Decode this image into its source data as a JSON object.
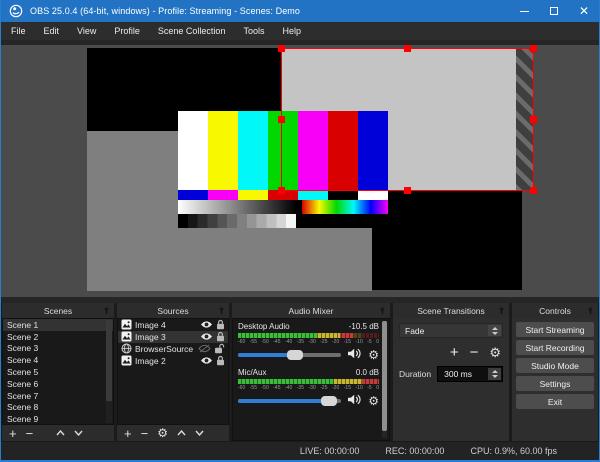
{
  "window": {
    "title": "OBS 25.0.4 (64-bit, windows) - Profile: Streaming - Scenes: Demo"
  },
  "menu": {
    "items": [
      "File",
      "Edit",
      "View",
      "Profile",
      "Scene Collection",
      "Tools",
      "Help"
    ]
  },
  "scenes": {
    "title": "Scenes",
    "items": [
      "Scene 1",
      "Scene 2",
      "Scene 3",
      "Scene 4",
      "Scene 5",
      "Scene 6",
      "Scene 7",
      "Scene 8",
      "Scene 9"
    ],
    "selected": "Scene 1"
  },
  "sources": {
    "title": "Sources",
    "items": [
      {
        "name": "Image 4",
        "type": "image",
        "visible": true,
        "locked": true
      },
      {
        "name": "Image 3",
        "type": "image",
        "visible": true,
        "locked": true,
        "selected": true
      },
      {
        "name": "BrowserSource",
        "type": "browser",
        "visible": false,
        "locked": false
      },
      {
        "name": "Image 2",
        "type": "image",
        "visible": true,
        "locked": true
      }
    ]
  },
  "mixer": {
    "title": "Audio Mixer",
    "ticks": [
      "-60",
      "-55",
      "-50",
      "-45",
      "-40",
      "-35",
      "-30",
      "-25",
      "-20",
      "-15",
      "-10",
      "-5",
      "0"
    ],
    "channels": [
      {
        "name": "Desktop Audio",
        "value": "-10.5 dB",
        "meter_pct": 82,
        "slider_pct": 55
      },
      {
        "name": "Mic/Aux",
        "value": "0.0 dB",
        "meter_pct": 100,
        "slider_pct": 88
      }
    ]
  },
  "transitions": {
    "title": "Scene Transitions",
    "selected": "Fade",
    "duration_label": "Duration",
    "duration_value": "300 ms"
  },
  "controls": {
    "title": "Controls",
    "buttons": [
      "Start Streaming",
      "Start Recording",
      "Studio Mode",
      "Settings",
      "Exit"
    ]
  },
  "statusbar": {
    "live": "LIVE: 00:00:00",
    "rec": "REC: 00:00:00",
    "cpu": "CPU: 0.9%, 60.00 fps"
  },
  "canvas": {
    "bar_colors": [
      "#ffffff",
      "#f8f800",
      "#00f8f8",
      "#00d800",
      "#f800f8",
      "#d80000",
      "#0000d8"
    ],
    "castellation_colors": [
      "#0000d8",
      "#f800f8",
      "#f8f800",
      "#d80000",
      "#00f8f8",
      "#000000",
      "#ffffff"
    ]
  },
  "colors": {
    "titlebar": "#2273c4",
    "accent_blue": "#2b7cd3",
    "selection_red": "#ff0000",
    "slider_blue": "#2f7fd6"
  }
}
